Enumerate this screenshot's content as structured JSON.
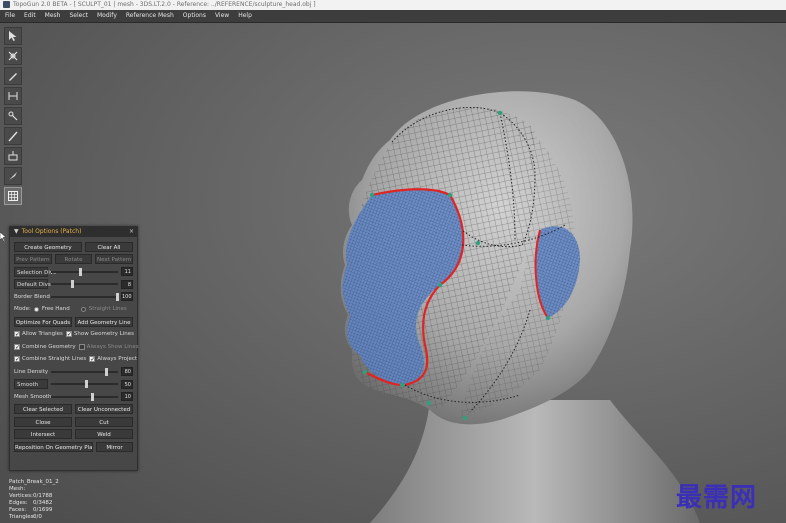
{
  "window": {
    "title": "TopoGun 2.0 BETA - [ SCULPT_01 | mesh - 3DS.LT.2.0 - Reference: ../REFERENCE/sculpture_head.obj ]"
  },
  "menu": [
    "File",
    "Edit",
    "Mesh",
    "Select",
    "Modify",
    "Reference Mesh",
    "Options",
    "View",
    "Help"
  ],
  "toolbar": {
    "tools": [
      "select-tool-icon",
      "edit-tool-icon",
      "create-tool-icon",
      "bridge-tool-icon",
      "brush-tool-icon",
      "draw-tool-icon",
      "extrude-tool-icon",
      "knife-tool-icon",
      "patch-tool-icon"
    ],
    "active_index": 8
  },
  "panel": {
    "title": "Tool Options (Patch)",
    "btn_create_geometry": "Create Geometry",
    "btn_clear_all": "Clear All",
    "btn_prev_pattern": "Prev Pattern",
    "btn_rotate": "Rotate",
    "btn_next_pattern": "Next Pattern",
    "subdivision_label": "Selection Divs",
    "subdivision_value": "11",
    "subdivision_level": 0.42,
    "default_divs_label": "Default Divs",
    "default_divs_value": "8",
    "default_divs_level": 0.3,
    "smooth_blend_label": "Border Blend",
    "smooth_blend_value": "100",
    "smooth_blend_level": 1.0,
    "mode_label": "Mode:",
    "mode_option_1": "Free Hand",
    "mode_option_2": "Straight Lines",
    "btn_optimize": "Optimize For Quads",
    "btn_add_geometry_line": "Add Geometry Line",
    "chk_allow_triangles": "Allow Triangles",
    "chk_show_geometry_lines": "Show Geometry Lines",
    "chk_combine_geometry": "Combine Geometry",
    "chk_always_show_lines": "Always Show Lines",
    "chk_combine_straight_lines": "Combine Straight Lines",
    "chk_always_project": "Always Project",
    "line_density_label": "Line Density",
    "line_density_value": "80",
    "line_density_level": 0.8,
    "smooth_label": "Smooth",
    "smooth_value": "50",
    "smooth_level": 0.5,
    "mesh_smooth_label": "Mesh Smooth",
    "mesh_smooth_value": "10",
    "mesh_smooth_level": 0.6,
    "btn_clear_selected": "Clear Selected",
    "btn_clear_unconnected": "Clear Unconnected",
    "btn_close": "Close",
    "btn_cut": "Cut",
    "btn_intersect": "Intersect",
    "btn_weld": "Weld",
    "btn_reposition": "Reposition On Geometry Plane",
    "btn_mirror": "Mirror"
  },
  "info": [
    {
      "k": "Patch_Break_01_2",
      "v": ""
    },
    {
      "k": "Mesh:",
      "v": ""
    },
    {
      "k": "Vertices:",
      "v": "0/1788"
    },
    {
      "k": "Edges:",
      "v": "0/3482"
    },
    {
      "k": "Faces:",
      "v": "0/1699"
    },
    {
      "k": "Triangles:",
      "v": "0/0"
    }
  ],
  "watermark": "最需网",
  "colors": {
    "patch_border": "#e02424",
    "patch_fill": "#5f86c9",
    "vertex": "#2fa07d",
    "panel_title": "#e8b24a"
  }
}
